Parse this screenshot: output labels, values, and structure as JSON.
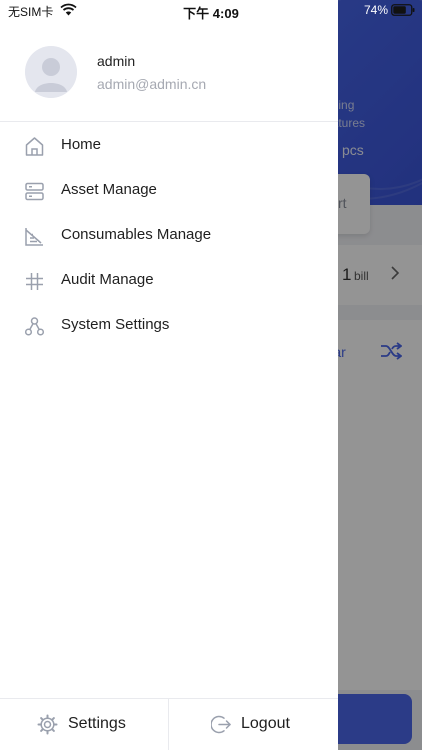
{
  "status_bar": {
    "carrier": "无SIM卡",
    "time": "下午 4:09",
    "battery": "74%",
    "battery_level": 0.74
  },
  "background": {
    "pending_text_line1": "nding",
    "pending_text_line2": "natures",
    "pcs_text": "pcs",
    "card_text": "rt",
    "bill_count": "1",
    "bill_unit": "bill",
    "tab_label": "Bar"
  },
  "drawer": {
    "user_name": "admin",
    "user_email": "admin@admin.cn",
    "menu": [
      {
        "label": "Home",
        "icon": "home-icon"
      },
      {
        "label": "Asset Manage",
        "icon": "server-icon"
      },
      {
        "label": "Consumables Manage",
        "icon": "chart-icon"
      },
      {
        "label": "Audit Manage",
        "icon": "hash-icon"
      },
      {
        "label": "System Settings",
        "icon": "nodes-icon"
      }
    ],
    "footer": {
      "settings_label": "Settings",
      "logout_label": "Logout"
    }
  },
  "colors": {
    "accent": "#4a67e8",
    "icon_gray": "#9aa0ad"
  }
}
